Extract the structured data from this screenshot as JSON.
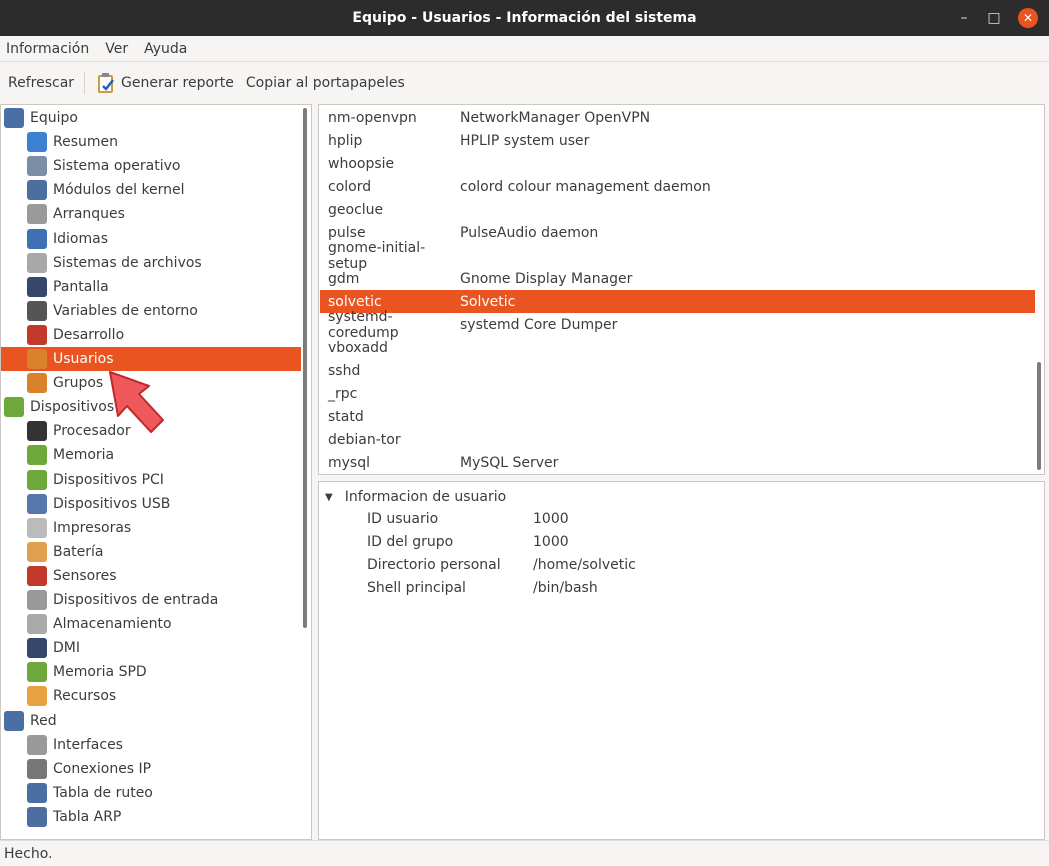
{
  "window": {
    "title": "Equipo - Usuarios - Información del sistema",
    "minimize": "–",
    "maximize": "□",
    "close": "✕"
  },
  "menu": [
    "Información",
    "Ver",
    "Ayuda"
  ],
  "toolbar": {
    "refresh": "Refrescar",
    "report": "Generar reporte",
    "copy": "Copiar al portapapeles"
  },
  "tree": [
    {
      "label": "Equipo",
      "level": 0,
      "icon": "computer-icon",
      "color": "#4a6fa5"
    },
    {
      "label": "Resumen",
      "level": 1,
      "icon": "info-icon",
      "color": "#3d7fd1"
    },
    {
      "label": "Sistema operativo",
      "level": 1,
      "icon": "gear-icon",
      "color": "#7a8ea8"
    },
    {
      "label": "Módulos del kernel",
      "level": 1,
      "icon": "module-icon",
      "color": "#4c6fa0"
    },
    {
      "label": "Arranques",
      "level": 1,
      "icon": "power-icon",
      "color": "#9a9a9a"
    },
    {
      "label": "Idiomas",
      "level": 1,
      "icon": "flag-icon",
      "color": "#3f6fb5"
    },
    {
      "label": "Sistemas de archivos",
      "level": 1,
      "icon": "drive-icon",
      "color": "#a8a8a8"
    },
    {
      "label": "Pantalla",
      "level": 1,
      "icon": "monitor-icon",
      "color": "#36476b"
    },
    {
      "label": "Variables de entorno",
      "level": 1,
      "icon": "terminal-icon",
      "color": "#555"
    },
    {
      "label": "Desarrollo",
      "level": 1,
      "icon": "devel-icon",
      "color": "#c0392b"
    },
    {
      "label": "Usuarios",
      "level": 1,
      "icon": "users-icon",
      "color": "#d9822b",
      "selected": true
    },
    {
      "label": "Grupos",
      "level": 1,
      "icon": "groups-icon",
      "color": "#d9822b"
    },
    {
      "label": "Dispositivos",
      "level": 0,
      "icon": "board-icon",
      "color": "#6fa83a"
    },
    {
      "label": "Procesador",
      "level": 1,
      "icon": "cpu-icon",
      "color": "#333"
    },
    {
      "label": "Memoria",
      "level": 1,
      "icon": "memory-icon",
      "color": "#6fa83a"
    },
    {
      "label": "Dispositivos PCI",
      "level": 1,
      "icon": "pci-icon",
      "color": "#6fa83a"
    },
    {
      "label": "Dispositivos USB",
      "level": 1,
      "icon": "usb-icon",
      "color": "#5577aa"
    },
    {
      "label": "Impresoras",
      "level": 1,
      "icon": "printer-icon",
      "color": "#bbb"
    },
    {
      "label": "Batería",
      "level": 1,
      "icon": "battery-icon",
      "color": "#e0a050"
    },
    {
      "label": "Sensores",
      "level": 1,
      "icon": "thermometer-icon",
      "color": "#c0392b"
    },
    {
      "label": "Dispositivos de entrada",
      "level": 1,
      "icon": "input-icon",
      "color": "#999"
    },
    {
      "label": "Almacenamiento",
      "level": 1,
      "icon": "storage-icon",
      "color": "#aaa"
    },
    {
      "label": "DMI",
      "level": 1,
      "icon": "dmi-icon",
      "color": "#36476b"
    },
    {
      "label": "Memoria SPD",
      "level": 1,
      "icon": "spd-icon",
      "color": "#6fa83a"
    },
    {
      "label": "Recursos",
      "level": 1,
      "icon": "resources-icon",
      "color": "#e8a040"
    },
    {
      "label": "Red",
      "level": 0,
      "icon": "network-icon",
      "color": "#4a6fa5"
    },
    {
      "label": "Interfaces",
      "level": 1,
      "icon": "interface-icon",
      "color": "#999"
    },
    {
      "label": "Conexiones IP",
      "level": 1,
      "icon": "plug-icon",
      "color": "#777"
    },
    {
      "label": "Tabla de ruteo",
      "level": 1,
      "icon": "routing-icon",
      "color": "#4a6fa5"
    },
    {
      "label": "Tabla ARP",
      "level": 1,
      "icon": "arp-icon",
      "color": "#4c6fa0"
    }
  ],
  "users": [
    [
      "nm-openvpn",
      "NetworkManager OpenVPN"
    ],
    [
      "hplip",
      "HPLIP system user"
    ],
    [
      "whoopsie",
      ""
    ],
    [
      "colord",
      "colord colour management daemon"
    ],
    [
      "geoclue",
      ""
    ],
    [
      "pulse",
      "PulseAudio daemon"
    ],
    [
      "gnome-initial-setup",
      ""
    ],
    [
      "gdm",
      "Gnome Display Manager"
    ],
    [
      "solvetic",
      "Solvetic"
    ],
    [
      "systemd-coredump",
      "systemd Core Dumper"
    ],
    [
      "vboxadd",
      ""
    ],
    [
      "sshd",
      ""
    ],
    [
      "_rpc",
      ""
    ],
    [
      "statd",
      ""
    ],
    [
      "debian-tor",
      ""
    ],
    [
      "mysql",
      "MySQL Server"
    ]
  ],
  "selected_user_index": 8,
  "details": {
    "header": "Informacion de usuario",
    "rows": [
      [
        "ID usuario",
        "1000"
      ],
      [
        "ID del grupo",
        "1000"
      ],
      [
        "Directorio personal",
        "/home/solvetic"
      ],
      [
        "Shell principal",
        "/bin/bash"
      ]
    ]
  },
  "status": "Hecho.",
  "colors": {
    "accent": "#e95420",
    "titlebar": "#2c2c2c"
  }
}
